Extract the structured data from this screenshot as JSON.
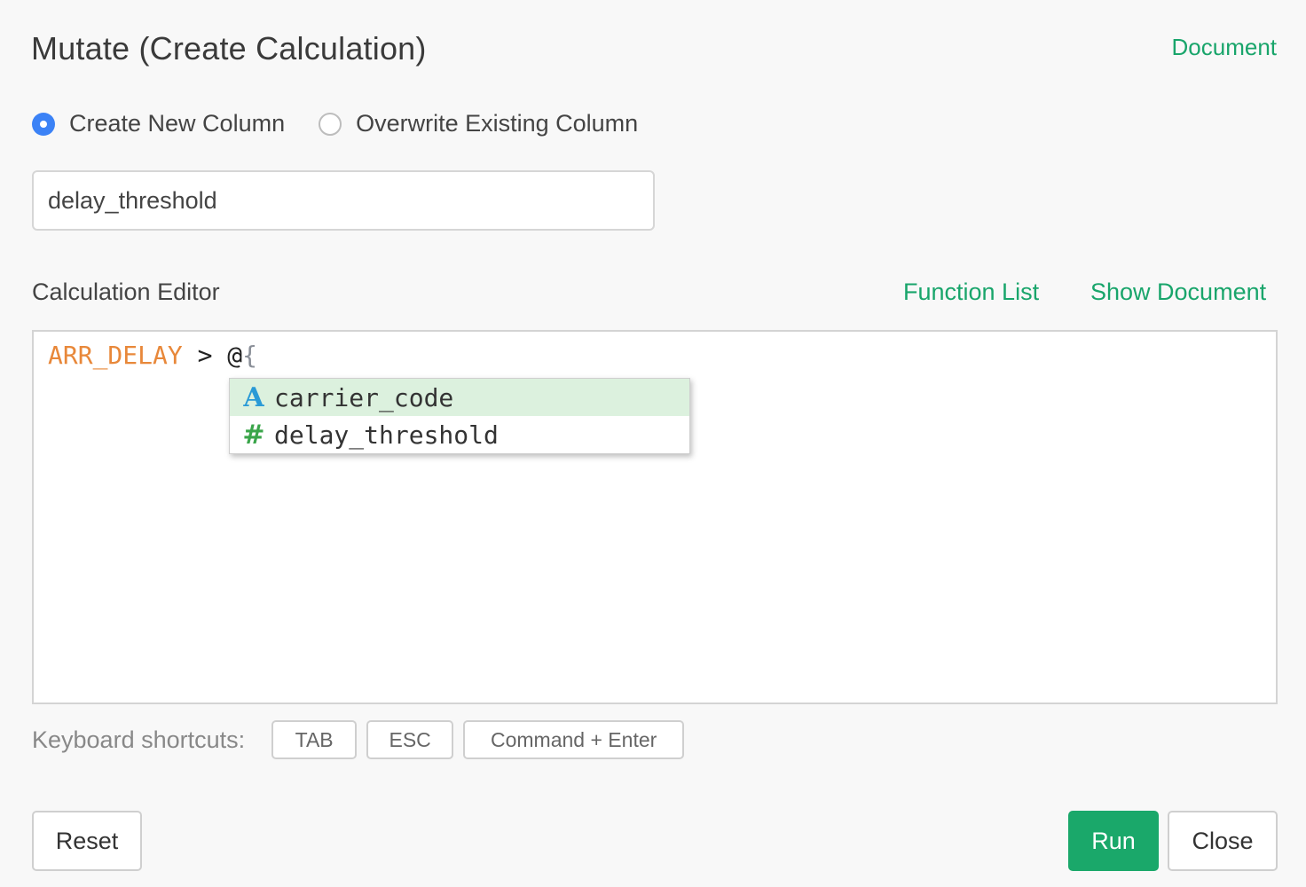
{
  "header": {
    "title": "Mutate (Create Calculation)",
    "document_link": "Document"
  },
  "mode": {
    "options": [
      {
        "label": "Create New Column",
        "checked": true
      },
      {
        "label": "Overwrite Existing Column",
        "checked": false
      }
    ]
  },
  "column_name": {
    "value": "delay_threshold"
  },
  "editor": {
    "section_label": "Calculation Editor",
    "function_list_link": "Function List",
    "show_document_link": "Show Document",
    "code": {
      "column_token": "ARR_DELAY",
      "operator_token": " > ",
      "at_token": "@",
      "brace_token": "{"
    },
    "autocomplete": [
      {
        "type_icon": "A",
        "icon_name": "text-type-icon",
        "label": "carrier_code",
        "selected": true
      },
      {
        "type_icon": "#",
        "icon_name": "number-type-icon",
        "label": "delay_threshold",
        "selected": false
      }
    ]
  },
  "shortcuts": {
    "label": "Keyboard shortcuts:",
    "keys": [
      "TAB",
      "ESC",
      "Command + Enter"
    ]
  },
  "footer": {
    "reset_label": "Reset",
    "run_label": "Run",
    "close_label": "Close"
  },
  "colors": {
    "accent_green": "#19a56b",
    "run_button": "#1aa86a",
    "radio_checked": "#3b82f6",
    "column_token": "#e8883a",
    "autocomplete_selected": "#dcf1de"
  }
}
